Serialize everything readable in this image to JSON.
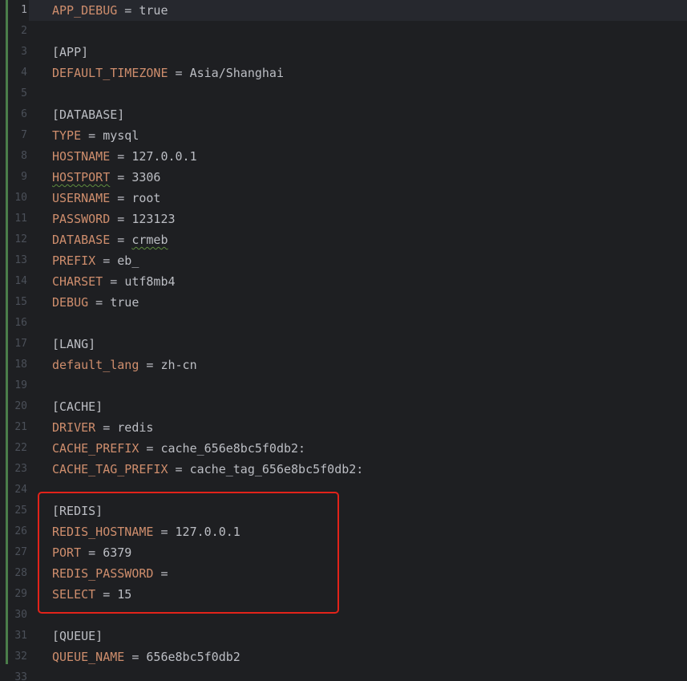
{
  "editor": {
    "active_line": 1,
    "lines": [
      {
        "n": "1",
        "parts": [
          {
            "t": "APP_DEBUG",
            "c": "key"
          },
          {
            "t": " = ",
            "c": "op"
          },
          {
            "t": "true",
            "c": "val"
          }
        ]
      },
      {
        "n": "2",
        "parts": []
      },
      {
        "n": "3",
        "parts": [
          {
            "t": "[APP]",
            "c": "sec"
          }
        ]
      },
      {
        "n": "4",
        "parts": [
          {
            "t": "DEFAULT_TIMEZONE",
            "c": "key"
          },
          {
            "t": " = ",
            "c": "op"
          },
          {
            "t": "Asia/Shanghai",
            "c": "val"
          }
        ]
      },
      {
        "n": "5",
        "parts": []
      },
      {
        "n": "6",
        "parts": [
          {
            "t": "[DATABASE]",
            "c": "sec"
          }
        ]
      },
      {
        "n": "7",
        "parts": [
          {
            "t": "TYPE",
            "c": "key"
          },
          {
            "t": " = ",
            "c": "op"
          },
          {
            "t": "mysql",
            "c": "val"
          }
        ]
      },
      {
        "n": "8",
        "parts": [
          {
            "t": "HOSTNAME",
            "c": "key"
          },
          {
            "t": " = ",
            "c": "op"
          },
          {
            "t": "127.0.0.1",
            "c": "val"
          }
        ]
      },
      {
        "n": "9",
        "parts": [
          {
            "t": "HOSTPORT",
            "c": "key typo"
          },
          {
            "t": " = ",
            "c": "op"
          },
          {
            "t": "3306",
            "c": "val"
          }
        ]
      },
      {
        "n": "10",
        "parts": [
          {
            "t": "USERNAME",
            "c": "key"
          },
          {
            "t": " = ",
            "c": "op"
          },
          {
            "t": "root",
            "c": "val"
          }
        ]
      },
      {
        "n": "11",
        "parts": [
          {
            "t": "PASSWORD",
            "c": "key"
          },
          {
            "t": " = ",
            "c": "op"
          },
          {
            "t": "123123",
            "c": "val"
          }
        ]
      },
      {
        "n": "12",
        "parts": [
          {
            "t": "DATABASE",
            "c": "key"
          },
          {
            "t": " = ",
            "c": "op"
          },
          {
            "t": "crmeb",
            "c": "val typo"
          }
        ]
      },
      {
        "n": "13",
        "parts": [
          {
            "t": "PREFIX",
            "c": "key"
          },
          {
            "t": " = ",
            "c": "op"
          },
          {
            "t": "eb_",
            "c": "val"
          }
        ]
      },
      {
        "n": "14",
        "parts": [
          {
            "t": "CHARSET",
            "c": "key"
          },
          {
            "t": " = ",
            "c": "op"
          },
          {
            "t": "utf8mb4",
            "c": "val"
          }
        ]
      },
      {
        "n": "15",
        "parts": [
          {
            "t": "DEBUG",
            "c": "key"
          },
          {
            "t": " = ",
            "c": "op"
          },
          {
            "t": "true",
            "c": "val"
          }
        ]
      },
      {
        "n": "16",
        "parts": []
      },
      {
        "n": "17",
        "parts": [
          {
            "t": "[LANG]",
            "c": "sec"
          }
        ]
      },
      {
        "n": "18",
        "parts": [
          {
            "t": "default_lang",
            "c": "key"
          },
          {
            "t": " = ",
            "c": "op"
          },
          {
            "t": "zh-cn",
            "c": "val"
          }
        ]
      },
      {
        "n": "19",
        "parts": []
      },
      {
        "n": "20",
        "parts": [
          {
            "t": "[CACHE]",
            "c": "sec"
          }
        ]
      },
      {
        "n": "21",
        "parts": [
          {
            "t": "DRIVER",
            "c": "key"
          },
          {
            "t": " = ",
            "c": "op"
          },
          {
            "t": "redis",
            "c": "val"
          }
        ]
      },
      {
        "n": "22",
        "parts": [
          {
            "t": "CACHE_PREFIX",
            "c": "key"
          },
          {
            "t": " = ",
            "c": "op"
          },
          {
            "t": "cache_656e8bc5f0db2:",
            "c": "val"
          }
        ]
      },
      {
        "n": "23",
        "parts": [
          {
            "t": "CACHE_TAG_PREFIX",
            "c": "key"
          },
          {
            "t": " = ",
            "c": "op"
          },
          {
            "t": "cache_tag_656e8bc5f0db2:",
            "c": "val"
          }
        ]
      },
      {
        "n": "24",
        "parts": []
      },
      {
        "n": "25",
        "parts": [
          {
            "t": "[REDIS]",
            "c": "sec"
          }
        ]
      },
      {
        "n": "26",
        "parts": [
          {
            "t": "REDIS_HOSTNAME",
            "c": "key"
          },
          {
            "t": " = ",
            "c": "op"
          },
          {
            "t": "127.0.0.1",
            "c": "val"
          }
        ]
      },
      {
        "n": "27",
        "parts": [
          {
            "t": "PORT",
            "c": "key"
          },
          {
            "t": " = ",
            "c": "op"
          },
          {
            "t": "6379",
            "c": "val"
          }
        ]
      },
      {
        "n": "28",
        "parts": [
          {
            "t": "REDIS_PASSWORD",
            "c": "key"
          },
          {
            "t": " = ",
            "c": "op"
          }
        ]
      },
      {
        "n": "29",
        "parts": [
          {
            "t": "SELECT",
            "c": "key"
          },
          {
            "t": " = ",
            "c": "op"
          },
          {
            "t": "15",
            "c": "val"
          }
        ]
      },
      {
        "n": "30",
        "parts": []
      },
      {
        "n": "31",
        "parts": [
          {
            "t": "[QUEUE]",
            "c": "sec"
          }
        ]
      },
      {
        "n": "32",
        "parts": [
          {
            "t": "QUEUE_NAME",
            "c": "key"
          },
          {
            "t": " = ",
            "c": "op"
          },
          {
            "t": "656e8bc5f0db2",
            "c": "val"
          }
        ]
      },
      {
        "n": "33",
        "parts": []
      }
    ]
  },
  "colors": {
    "background": "#1e1f22",
    "key": "#cf8e6d",
    "text": "#bcbec4",
    "line_number": "#4b5059",
    "change_bar": "#4a7d4a",
    "highlight_box": "#e2231a"
  }
}
